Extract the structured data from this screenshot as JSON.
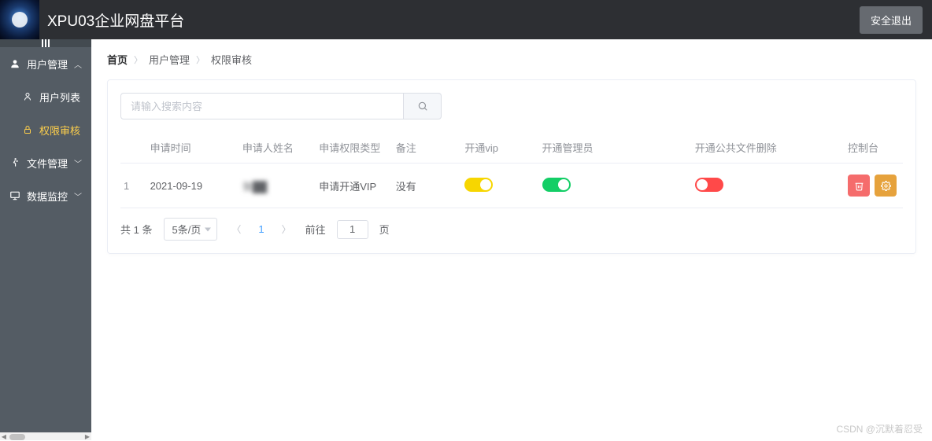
{
  "header": {
    "title": "XPU03企业网盘平台",
    "logout": "安全退出"
  },
  "sidebar": {
    "items": [
      {
        "label": "用户管理",
        "icon": "user-icon",
        "expanded": true
      },
      {
        "label": "用户列表",
        "icon": "person-icon",
        "sub": true
      },
      {
        "label": "权限审核",
        "icon": "lock-icon",
        "sub": true,
        "active": true
      },
      {
        "label": "文件管理",
        "icon": "run-icon",
        "expanded": false
      },
      {
        "label": "数据监控",
        "icon": "monitor-icon",
        "expanded": false
      }
    ]
  },
  "breadcrumb": {
    "items": [
      "首页",
      "用户管理",
      "权限审核"
    ]
  },
  "search": {
    "placeholder": "请输入搜索内容"
  },
  "table": {
    "headers": [
      "",
      "申请时间",
      "申请人姓名",
      "申请权限类型",
      "备注",
      "开通vip",
      "开通管理员",
      "开通公共文件删除",
      "控制台"
    ],
    "rows": [
      {
        "index": "1",
        "time": "2021-09-19",
        "name": "张██",
        "type": "申请开通VIP",
        "note": "没有",
        "vip": {
          "on": true,
          "color": "yellow"
        },
        "admin": {
          "on": true,
          "color": "green"
        },
        "delete": {
          "on": false,
          "color": "red"
        }
      }
    ]
  },
  "pagination": {
    "total_prefix": "共",
    "total_count": "1",
    "total_suffix": "条",
    "page_size": "5条/页",
    "current": "1",
    "goto_prefix": "前往",
    "goto_value": "1",
    "goto_suffix": "页"
  },
  "watermark": "CSDN @沉默着忍受"
}
